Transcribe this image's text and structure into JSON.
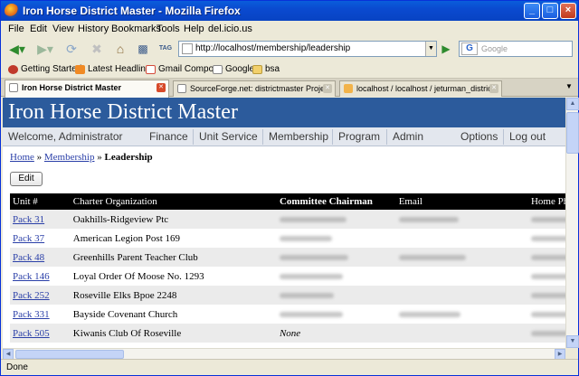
{
  "window": {
    "title": "Iron Horse District Master - Mozilla Firefox",
    "minimize": "_",
    "maximize": "□",
    "close": "×"
  },
  "menu": [
    "File",
    "Edit",
    "View",
    "History",
    "Bookmarks",
    "Tools",
    "Help",
    "del.icio.us"
  ],
  "toolbar": {
    "url": "http://localhost/membership/leadership",
    "search_placeholder": "Google",
    "search_engine_glyph": "G",
    "tag_label": "TAG"
  },
  "bookmarks": [
    {
      "label": "Getting Started",
      "color": "#c0392b"
    },
    {
      "label": "Latest Headlines",
      "color": "#f08a24"
    },
    {
      "label": "Gmail Compose",
      "color": "#d44b3a"
    },
    {
      "label": "Google",
      "color": "#ffffff"
    },
    {
      "label": "bsa",
      "color": "#f2d06b"
    }
  ],
  "tabs": [
    {
      "label": "Iron Horse District Master",
      "active": true
    },
    {
      "label": "SourceForge.net: districtmaster Proje...",
      "active": false
    },
    {
      "label": "localhost / localhost / jeturman_distric...",
      "active": false
    }
  ],
  "page": {
    "site_title": "Iron Horse District Master",
    "welcome": "Welcome, Administrator",
    "nav": [
      "Finance",
      "Unit Service",
      "Membership",
      "Program",
      "Admin"
    ],
    "nav_right": [
      "Options",
      "Log out"
    ],
    "breadcrumb": {
      "home": "Home",
      "sep1": " » ",
      "membership": "Membership",
      "sep2": " » ",
      "current": "Leadership"
    },
    "edit_label": "Edit",
    "columns": [
      "Unit #",
      "Charter Organization",
      "Committee Chairman",
      "Email",
      "Home Ph"
    ],
    "rows": [
      {
        "unit": "Pack 31",
        "org": "Oakhills-Ridgeview Ptc",
        "chair": "",
        "email": "",
        "phone": ""
      },
      {
        "unit": "Pack 37",
        "org": "American Legion Post 169",
        "chair": "",
        "email": "",
        "phone": ""
      },
      {
        "unit": "Pack 48",
        "org": "Greenhills Parent Teacher Club",
        "chair": "",
        "email": "",
        "phone": ""
      },
      {
        "unit": "Pack 146",
        "org": "Loyal Order Of Moose No. 1293",
        "chair": "",
        "email": "",
        "phone": ""
      },
      {
        "unit": "Pack 252",
        "org": "Roseville Elks Bpoe 2248",
        "chair": "",
        "email": "",
        "phone": ""
      },
      {
        "unit": "Pack 331",
        "org": "Bayside Covenant Church",
        "chair": "",
        "email": "",
        "phone": ""
      },
      {
        "unit": "Pack 505",
        "org": "Kiwanis Club Of Roseville",
        "chair": "None",
        "email": "",
        "phone": ""
      }
    ]
  },
  "status": "Done"
}
